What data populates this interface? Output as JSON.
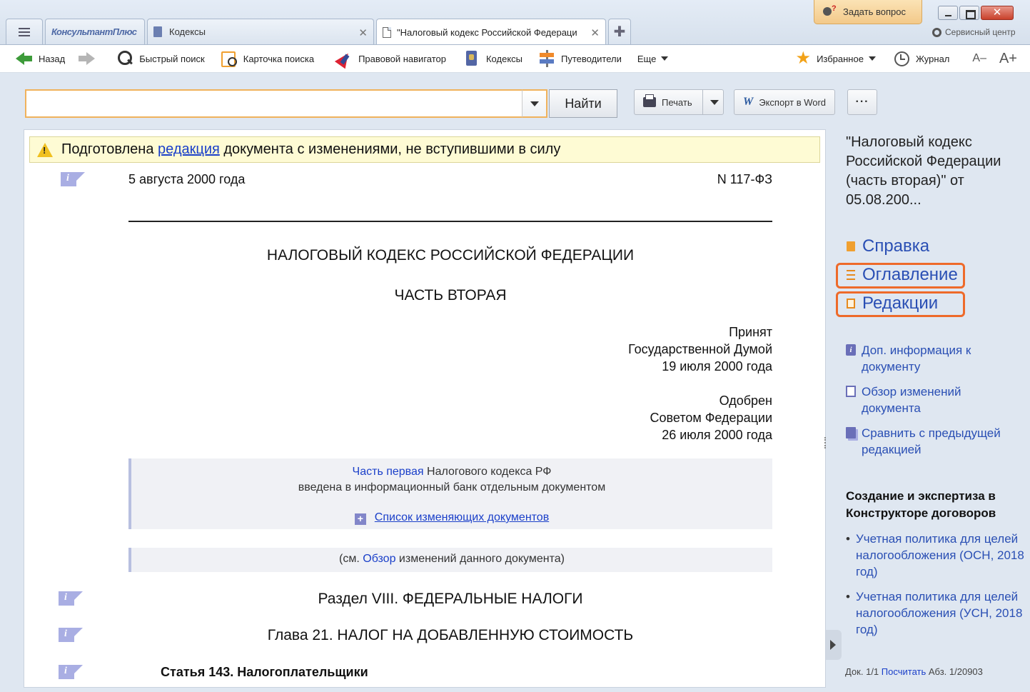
{
  "window": {
    "tabs": [
      {
        "label": "КонсультантПлюс"
      },
      {
        "label": "Кодексы"
      },
      {
        "label": "\"Налоговый кодекс Российской Федераци"
      }
    ],
    "ask_label": "Задать вопрос",
    "service_label": "Сервисный центр"
  },
  "toolbar": {
    "back": "Назад",
    "quick_search": "Быстрый поиск",
    "search_card": "Карточка поиска",
    "legal_navigator": "Правовой навигатор",
    "codexes": "Кодексы",
    "guides": "Путеводители",
    "more": "Еще",
    "favorites": "Избранное",
    "journal": "Журнал",
    "font_smaller": "A–",
    "font_bigger": "A+"
  },
  "search": {
    "value": "",
    "find_label": "Найти",
    "print_label": "Печать",
    "export_label": "Экспорт в Word",
    "more_label": "···"
  },
  "document": {
    "warning_prefix": "Подготовлена ",
    "warning_link": "редакция",
    "warning_suffix": " документа с изменениями, не вступившими в силу",
    "date": "5 августа 2000 года",
    "number": "N 117-ФЗ",
    "title": "НАЛОГОВЫЙ КОДЕКС РОССИЙСКОЙ ФЕДЕРАЦИИ",
    "part": "ЧАСТЬ ВТОРАЯ",
    "adopted": [
      "Принят",
      "Государственной Думой",
      "19 июля 2000 года"
    ],
    "approved": [
      "Одобрен",
      "Советом Федерации",
      "26 июля 2000 года"
    ],
    "note1_link": "Часть первая",
    "note1_rest": " Налогового кодекса РФ",
    "note1_line2": "введена в информационный банк отдельным документом",
    "note1_list_link": "Список изменяющих документов",
    "note2_prefix": "(см. ",
    "note2_link": "Обзор",
    "note2_suffix": " изменений данного документа)",
    "section": "Раздел VIII. ФЕДЕРАЛЬНЫЕ НАЛОГИ",
    "chapter": "Глава 21. НАЛОГ НА ДОБАВЛЕННУЮ СТОИМОСТЬ",
    "article": "Статья 143. Налогоплательщики"
  },
  "panel": {
    "title": "\"Налоговый кодекс Российской Федерации (часть вторая)\" от 05.08.200...",
    "nav": [
      "Справка",
      "Оглавление",
      "Редакции"
    ],
    "links": [
      "Доп. информация к документу",
      "Обзор изменений документа",
      "Сравнить с предыдущей редакцией"
    ],
    "promo_title": "Создание и экспертиза в Конструкторе договоров",
    "promo_items": [
      "Учетная политика для целей налогообложения (ОСН, 2018 год)",
      "Учетная политика для целей налогообложения (УСН, 2018 год)"
    ]
  },
  "status": {
    "doc": "Док. 1/1",
    "count_link": "Посчитать",
    "para": "Абз. 1/20903"
  },
  "colors": {
    "accent_orange": "#ee6a2a",
    "link_blue": "#1a3fc9",
    "warning_bg": "#fefbd4"
  }
}
